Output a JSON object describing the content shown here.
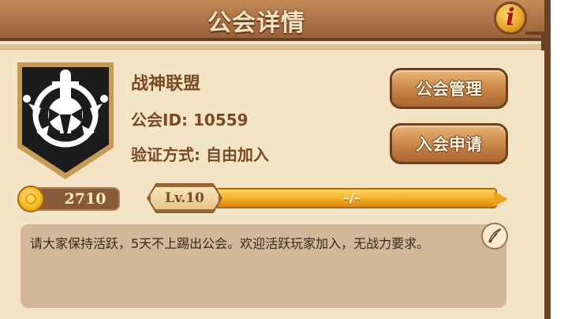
{
  "header": {
    "title": "公会详情",
    "info_icon_glyph": "i"
  },
  "guild": {
    "emblem_icon": "sword-shield-icon",
    "name": "战神联盟",
    "id_text": "公会ID: 10559",
    "verify_text": "验证方式: 自由加入"
  },
  "buttons": {
    "manage": "公会管理",
    "apply": "入会申请"
  },
  "coins": {
    "value": "2710",
    "icon": "gold-coin-icon"
  },
  "level": {
    "label": "Lv.10",
    "progress_text": "–/–"
  },
  "notice": {
    "text": "请大家保持活跃，5天不上踢出公会。欢迎活跃玩家加入，无战力要求。",
    "edit_icon": "quill-pen-icon"
  },
  "colors": {
    "panel": "#f3e4c6",
    "header": "#9a603a",
    "text_brown": "#7a4a25",
    "button": "#c88446",
    "level_bar": "#f4a820"
  }
}
